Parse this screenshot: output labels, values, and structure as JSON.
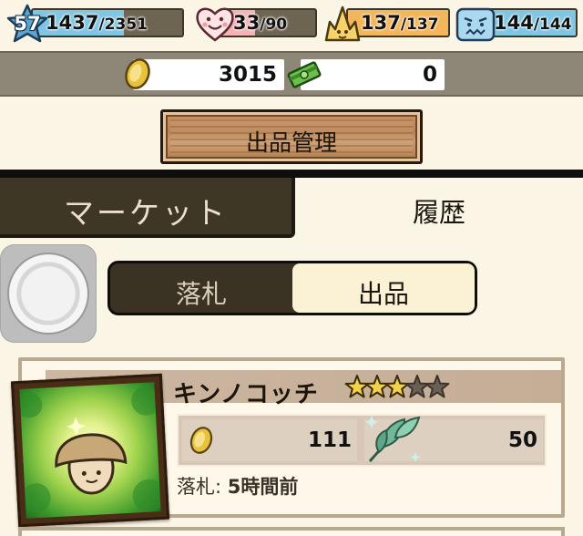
{
  "status": {
    "level": "57",
    "hp": {
      "current": "1437",
      "max": "/2351",
      "fill_fraction": 0.61
    },
    "heart": {
      "current": "33",
      "max": "/90",
      "fill_fraction": 0.37
    },
    "stamina": {
      "current": "137",
      "max": "/137",
      "fill_fraction": 1.0
    },
    "mood": {
      "current": "144",
      "max": "/144",
      "fill_fraction": 1.0
    }
  },
  "currency": {
    "coins": "3015",
    "cash": "0"
  },
  "buttons": {
    "manage_listings": "出品管理"
  },
  "tabs": {
    "market": "マーケット",
    "history": "履歴"
  },
  "segment": {
    "bid": "落札",
    "listing": "出品",
    "selected": "出品"
  },
  "item": {
    "name": "キンノコッチ",
    "stars_filled": 3,
    "stars_total": 5,
    "coin_price": "111",
    "leaf_price": "50",
    "bid_label": "落札: ",
    "bid_time": "5時間前"
  },
  "colors": {
    "hp_fill": "#7fc6e3",
    "heart_fill": "#f4b3b6",
    "stamina_fill": "#f3b65a",
    "mood_fill": "#7fc6e3",
    "market_tab_bg": "#3f3725",
    "page_bg": "#fbf5e6"
  }
}
